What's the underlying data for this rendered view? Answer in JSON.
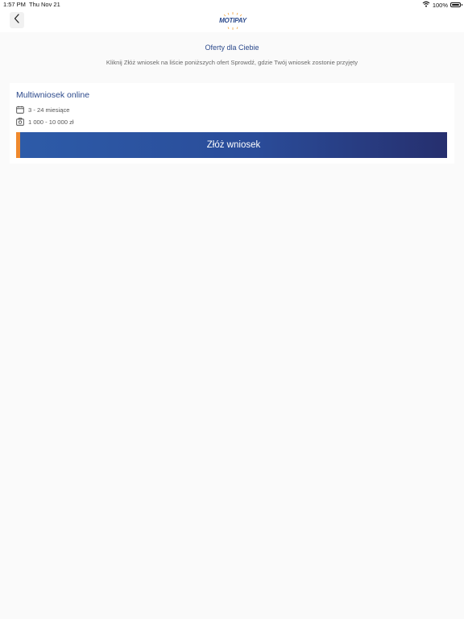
{
  "status_bar": {
    "time": "1:57 PM",
    "date": "Thu Nov 21",
    "battery": "100%"
  },
  "header": {
    "logo_text": "MOTIPAY",
    "logo_icon": "motipay-logo-icon",
    "back_icon": "chevron-left-icon"
  },
  "page": {
    "title": "Oferty dla Ciebie",
    "subtitle": "Kliknij Złóż wniosek na liście poniższych ofert Sprowdź, gdzie Twój wniosek zostonie przyjęty"
  },
  "offer": {
    "title": "Multiwniosek online",
    "period": "3 - 24 miesiące",
    "period_icon": "calendar-icon",
    "amount": "1 000 - 10 000 zł",
    "amount_icon": "money-icon",
    "button_label": "Złóż wniosek"
  },
  "colors": {
    "brand_blue": "#2c4a8c",
    "button_gradient_start": "#2d5ba8",
    "button_gradient_end": "#262f6e",
    "accent_orange": "#ef8a2e"
  }
}
